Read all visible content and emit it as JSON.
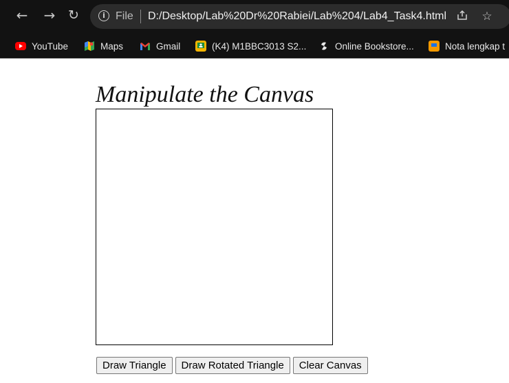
{
  "browser": {
    "url_prefix": "File",
    "url": "D:/Desktop/Lab%20Dr%20Rabiei/Lab%204/Lab4_Task4.html",
    "icons": {
      "back": "back-arrow-icon",
      "forward": "forward-arrow-icon",
      "reload": "reload-icon",
      "site_info": "info-icon",
      "share": "share-icon",
      "bookmark": "star-icon"
    },
    "bookmarks": [
      {
        "label": "YouTube",
        "icon": "youtube-icon"
      },
      {
        "label": "Maps",
        "icon": "maps-icon"
      },
      {
        "label": "Gmail",
        "icon": "gmail-icon"
      },
      {
        "label": "(K4) M1BBC3013 S2...",
        "icon": "classroom-icon"
      },
      {
        "label": "Online Bookstore...",
        "icon": "bookstore-icon"
      },
      {
        "label": "Nota lengkap t",
        "icon": "notes-icon"
      }
    ]
  },
  "page": {
    "title": "Manipulate the Canvas",
    "buttons": {
      "draw_triangle": "Draw Triangle",
      "draw_rotated_triangle": "Draw Rotated Triangle",
      "clear_canvas": "Clear Canvas"
    }
  },
  "colors": {
    "chrome_bg": "#121212",
    "omnibox_bg": "#2c2c2c",
    "page_bg": "#ffffff",
    "youtube_red": "#ff0000",
    "gmail_red": "#ea4335",
    "classroom_yellow": "#f4b400"
  }
}
